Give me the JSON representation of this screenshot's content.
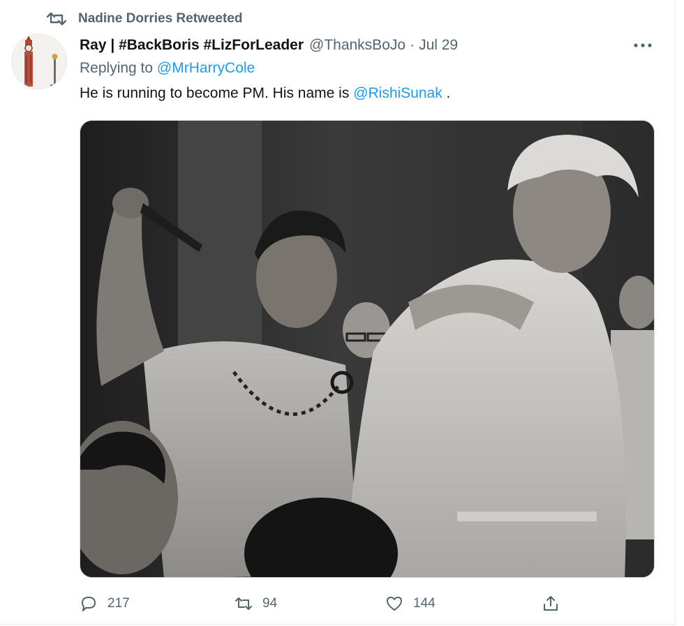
{
  "retweet": {
    "label": "Nadine Dorries Retweeted",
    "icon": "retweet-icon"
  },
  "tweet": {
    "display_name": "Ray | #BackBoris #LizForLeader",
    "handle": "@ThanksBoJo",
    "separator": "·",
    "date": "Jul 29",
    "replying_prefix": "Replying to",
    "replying_to": "@MrHarryCole",
    "text_before": "He is running to become PM. His name is",
    "text_mention": "@RishiSunak",
    "text_after": " ."
  },
  "actions": {
    "reply_count": "217",
    "retweet_count": "94",
    "like_count": "144"
  },
  "colors": {
    "secondary_text": "#536471",
    "mention": "#1d9bf0",
    "primary_text": "#0f1419",
    "border": "#cfd9de"
  }
}
